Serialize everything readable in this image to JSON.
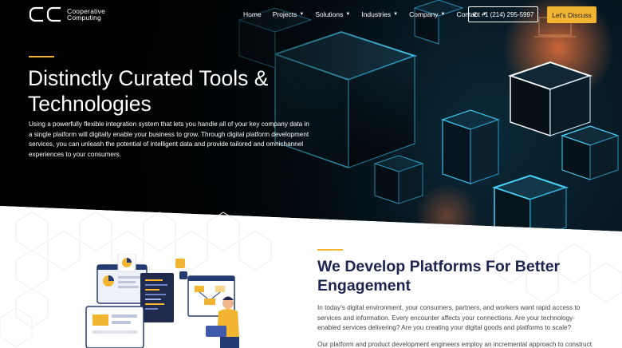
{
  "brand": {
    "logo_letters": "CC",
    "line1": "Cooperative",
    "line2": "Computing"
  },
  "nav": {
    "items": [
      {
        "label": "Home",
        "has_dropdown": false
      },
      {
        "label": "Projects",
        "has_dropdown": true
      },
      {
        "label": "Solutions",
        "has_dropdown": true
      },
      {
        "label": "Industries",
        "has_dropdown": true
      },
      {
        "label": "Company",
        "has_dropdown": true
      },
      {
        "label": "Contact",
        "has_dropdown": true
      }
    ],
    "phone": "+1 (214) 295-5997",
    "cta": "Let's Discuss"
  },
  "hero": {
    "title": "Distinctly Curated Tools & Technologies",
    "description": "Using a powerfully flexible integration system that lets you handle all of your key company data in a single platform will digitally enable your business to grow. Through digital platform development services, you can unleash the potential of intelligent data and provide tailored and omnichannel experiences to your consumers."
  },
  "section": {
    "title": "We Develop Platforms For Better Engagement",
    "paragraph1": "In today's digital environment, your consumers, partners, and workers want rapid access to services and information. Every encounter affects your connections. Are your technology-enabled services delivering? Are you creating your digital goods and platforms to scale?",
    "paragraph2": "Our platform and product development engineers employ an incremental approach to construct"
  },
  "colors": {
    "accent": "#f2b531",
    "heading": "#1c2451",
    "neon": "#3fd0ff"
  },
  "icons": {
    "chevron": "chevron-down-icon",
    "phone": "phone-icon"
  }
}
